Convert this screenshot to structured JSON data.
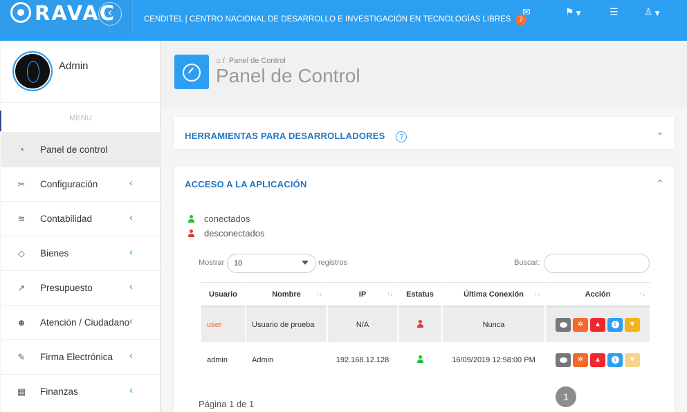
{
  "header": {
    "logo_text": "RAVAC",
    "org_title": "CENDITEL | CENTRO NACIONAL DE DESARROLLO E INVESTIGACIÓN EN TECNOLOGÍAS LIBRES",
    "messages_badge": "2"
  },
  "profile": {
    "name": "Admin"
  },
  "sidebar": {
    "menu_label": "MENU",
    "items": [
      {
        "label": "Panel de control",
        "icon": "dashboard-icon",
        "active": true
      },
      {
        "label": "Configuración",
        "icon": "tools-icon"
      },
      {
        "label": "Contabilidad",
        "icon": "layers-icon"
      },
      {
        "label": "Bienes",
        "icon": "tag-icon"
      },
      {
        "label": "Presupuesto",
        "icon": "trend-icon"
      },
      {
        "label": "Atención / Ciudadano",
        "icon": "people-icon"
      },
      {
        "label": "Firma Electrónica",
        "icon": "edit-icon"
      },
      {
        "label": "Finanzas",
        "icon": "calculator-icon"
      }
    ]
  },
  "page": {
    "breadcrumb": "Panel de Control",
    "title": "Panel de Control"
  },
  "dev_tools_panel": {
    "title": "HERRAMIENTAS PARA DESARROLLADORES",
    "help": "?"
  },
  "access_panel": {
    "title": "ACCESO A LA APLICACIÓN",
    "legend_connected": "conectados",
    "legend_disconnected": "desconectados",
    "show_label": "Mostrar",
    "show_value": "10",
    "records_label": "registros",
    "search_label": "Buscar:",
    "columns": [
      "Usuario",
      "Nombre",
      "IP",
      "Estatus",
      "Última Conexión",
      "Acción"
    ],
    "rows": [
      {
        "user": "user",
        "name": "Usuario de prueba",
        "ip": "N/A",
        "status": "disconnected",
        "last": "Nunca"
      },
      {
        "user": "admin",
        "name": "Admin",
        "ip": "192.168.12.128",
        "status": "connected",
        "last": "16/09/2019 12:58:00 PM"
      }
    ],
    "pagination_info": "Página 1 de 1",
    "current_page": "1"
  },
  "colors": {
    "primary": "#2d9ff2",
    "accent_orange": "#f36c3a",
    "connected": "#1fbf3a",
    "disconnected": "#e23a3a"
  }
}
